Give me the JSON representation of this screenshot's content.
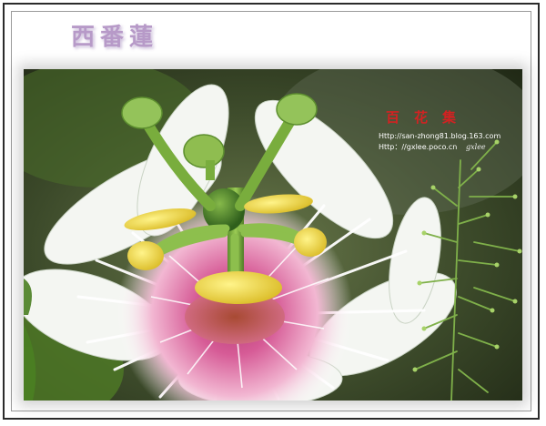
{
  "title": "西番蓮",
  "watermark": {
    "heading": "百花集",
    "url_1": "Http://san-zhong81.blog.163.com",
    "url_2": "Http：//gxlee.poco.cn",
    "signature": "gxlee"
  },
  "photo": {
    "subject": "passion-flower-closeup"
  },
  "colors": {
    "title": "#b79ac8",
    "frame": "#2b2b2b",
    "watermark_heading": "#d22222"
  }
}
